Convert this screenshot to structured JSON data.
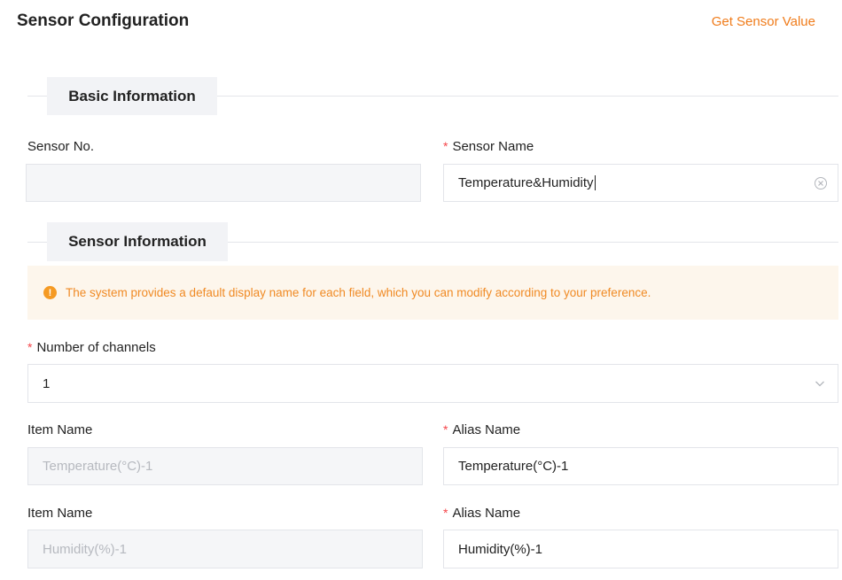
{
  "page": {
    "title": "Sensor Configuration",
    "get_value_link": "Get Sensor Value"
  },
  "basic_info": {
    "section_title": "Basic Information",
    "sensor_no": {
      "label": "Sensor No.",
      "value": ""
    },
    "sensor_name": {
      "label": "Sensor Name",
      "value": "Temperature&Humidity",
      "required": true
    }
  },
  "sensor_info": {
    "section_title": "Sensor Information",
    "notice": "The system provides a default display name for each field, which you can modify according to your preference.",
    "channels": {
      "label": "Number of channels",
      "value": "1",
      "required": true
    },
    "items": [
      {
        "item_label": "Item Name",
        "item_value": "Temperature(°C)-1",
        "alias_label": "Alias Name",
        "alias_value": "Temperature(°C)-1"
      },
      {
        "item_label": "Item Name",
        "item_value": "Humidity(%)-1",
        "alias_label": "Alias Name",
        "alias_value": "Humidity(%)-1"
      }
    ]
  },
  "colors": {
    "accent": "#f07c1b",
    "required": "#f5454a",
    "notice_bg": "#fdf6ec",
    "notice_text": "#f08a24"
  },
  "icons": {
    "clear": "circle-x-icon",
    "dropdown": "chevron-down-icon",
    "notice": "warning-circle-icon"
  }
}
